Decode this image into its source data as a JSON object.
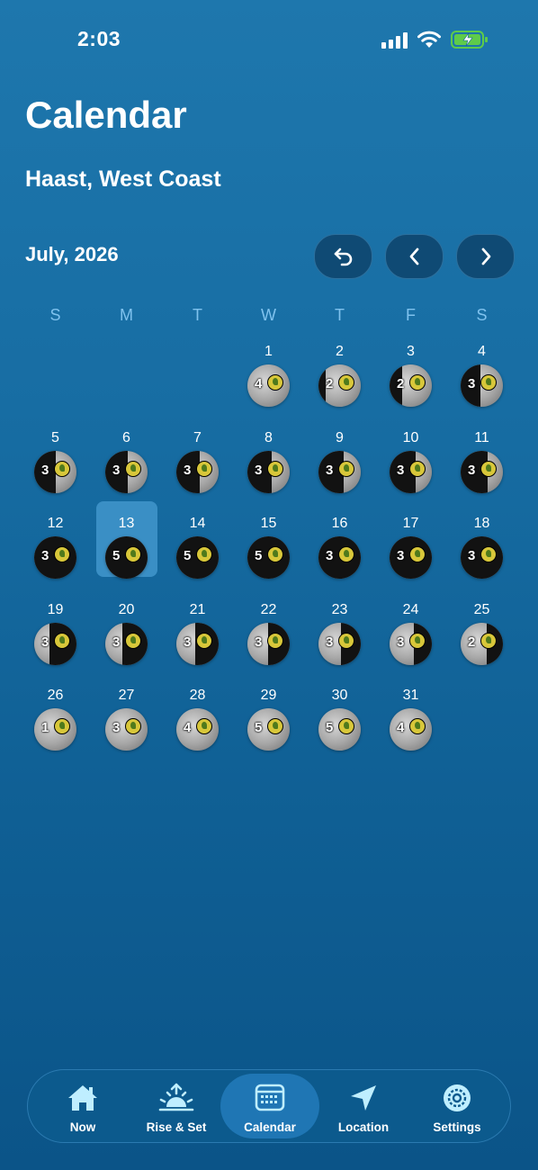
{
  "status_bar": {
    "time": "2:03"
  },
  "header": {
    "title": "Calendar",
    "location": "Haast, West Coast"
  },
  "calendar": {
    "month_label": "July, 2026",
    "weekdays": [
      "S",
      "M",
      "T",
      "W",
      "T",
      "F",
      "S"
    ],
    "first_weekday_index": 3,
    "selected_day": 13,
    "days": [
      {
        "day": "1",
        "rating": "4"
      },
      {
        "day": "2",
        "rating": "2"
      },
      {
        "day": "3",
        "rating": "2"
      },
      {
        "day": "4",
        "rating": "3"
      },
      {
        "day": "5",
        "rating": "3"
      },
      {
        "day": "6",
        "rating": "3"
      },
      {
        "day": "7",
        "rating": "3"
      },
      {
        "day": "8",
        "rating": "3"
      },
      {
        "day": "9",
        "rating": "3"
      },
      {
        "day": "10",
        "rating": "3"
      },
      {
        "day": "11",
        "rating": "3"
      },
      {
        "day": "12",
        "rating": "3"
      },
      {
        "day": "13",
        "rating": "5"
      },
      {
        "day": "14",
        "rating": "5"
      },
      {
        "day": "15",
        "rating": "5"
      },
      {
        "day": "16",
        "rating": "3"
      },
      {
        "day": "17",
        "rating": "3"
      },
      {
        "day": "18",
        "rating": "3"
      },
      {
        "day": "19",
        "rating": "3"
      },
      {
        "day": "20",
        "rating": "3"
      },
      {
        "day": "21",
        "rating": "3"
      },
      {
        "day": "22",
        "rating": "3"
      },
      {
        "day": "23",
        "rating": "3"
      },
      {
        "day": "24",
        "rating": "3"
      },
      {
        "day": "25",
        "rating": "2"
      },
      {
        "day": "26",
        "rating": "1"
      },
      {
        "day": "27",
        "rating": "3"
      },
      {
        "day": "28",
        "rating": "4"
      },
      {
        "day": "29",
        "rating": "5"
      },
      {
        "day": "30",
        "rating": "5"
      },
      {
        "day": "31",
        "rating": "4"
      }
    ],
    "nav_buttons": [
      "undo-icon",
      "chevron-left-icon",
      "chevron-right-icon"
    ]
  },
  "tabs": [
    {
      "id": "now",
      "label": "Now",
      "icon": "home-icon"
    },
    {
      "id": "rise",
      "label": "Rise & Set",
      "icon": "sunrise-icon"
    },
    {
      "id": "calendar",
      "label": "Calendar",
      "icon": "calendar-icon",
      "active": true
    },
    {
      "id": "location",
      "label": "Location",
      "icon": "location-arrow-icon"
    },
    {
      "id": "settings",
      "label": "Settings",
      "icon": "gear-icon"
    }
  ],
  "colors": {
    "accent": "#7fc2ee",
    "selected_cell": "#3a8fc5",
    "tab_active": "#1f76b4"
  }
}
